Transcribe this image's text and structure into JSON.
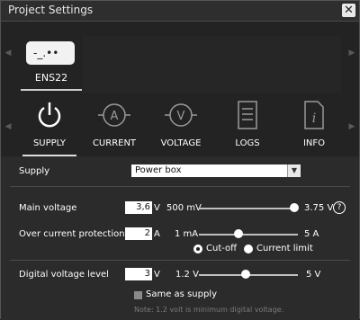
{
  "window": {
    "title": "Project Settings",
    "close_glyph": "✕"
  },
  "device": {
    "name": "ENS22",
    "display_text": "-_.••"
  },
  "tabs": [
    {
      "label": "SUPPLY",
      "icon": "power-icon",
      "active": true
    },
    {
      "label": "CURRENT",
      "icon": "ammeter-icon",
      "active": false
    },
    {
      "label": "VOLTAGE",
      "icon": "voltmeter-icon",
      "active": false
    },
    {
      "label": "LOGS",
      "icon": "document-icon",
      "active": false
    },
    {
      "label": "INFO",
      "icon": "info-icon",
      "active": false
    }
  ],
  "supply": {
    "label": "Supply",
    "selected": "Power box"
  },
  "main_voltage": {
    "label": "Main voltage",
    "value": "3,6",
    "unit": "V",
    "min_label": "500 mV",
    "max_label": "3.75 V",
    "slider_fraction": 0.96,
    "help_glyph": "?"
  },
  "over_current": {
    "label": "Over current protection",
    "value": "2",
    "unit": "A",
    "min_label": "1 mA",
    "max_label": "5 A",
    "slider_fraction": 0.4,
    "options": [
      "Cut-off",
      "Current limit"
    ],
    "selected_option": "Cut-off"
  },
  "digital_voltage": {
    "label": "Digital voltage level",
    "value": "3",
    "unit": "V",
    "min_label": "1.2 V",
    "max_label": "5 V",
    "slider_fraction": 0.47,
    "same_as_supply_label": "Same as supply",
    "note": "Note: 1.2 volt is minimum digital voltage."
  },
  "colors": {
    "background": "#2b2b2b",
    "header_band": "#232323",
    "text": "#ffffff",
    "note": "#7a7a7a"
  }
}
